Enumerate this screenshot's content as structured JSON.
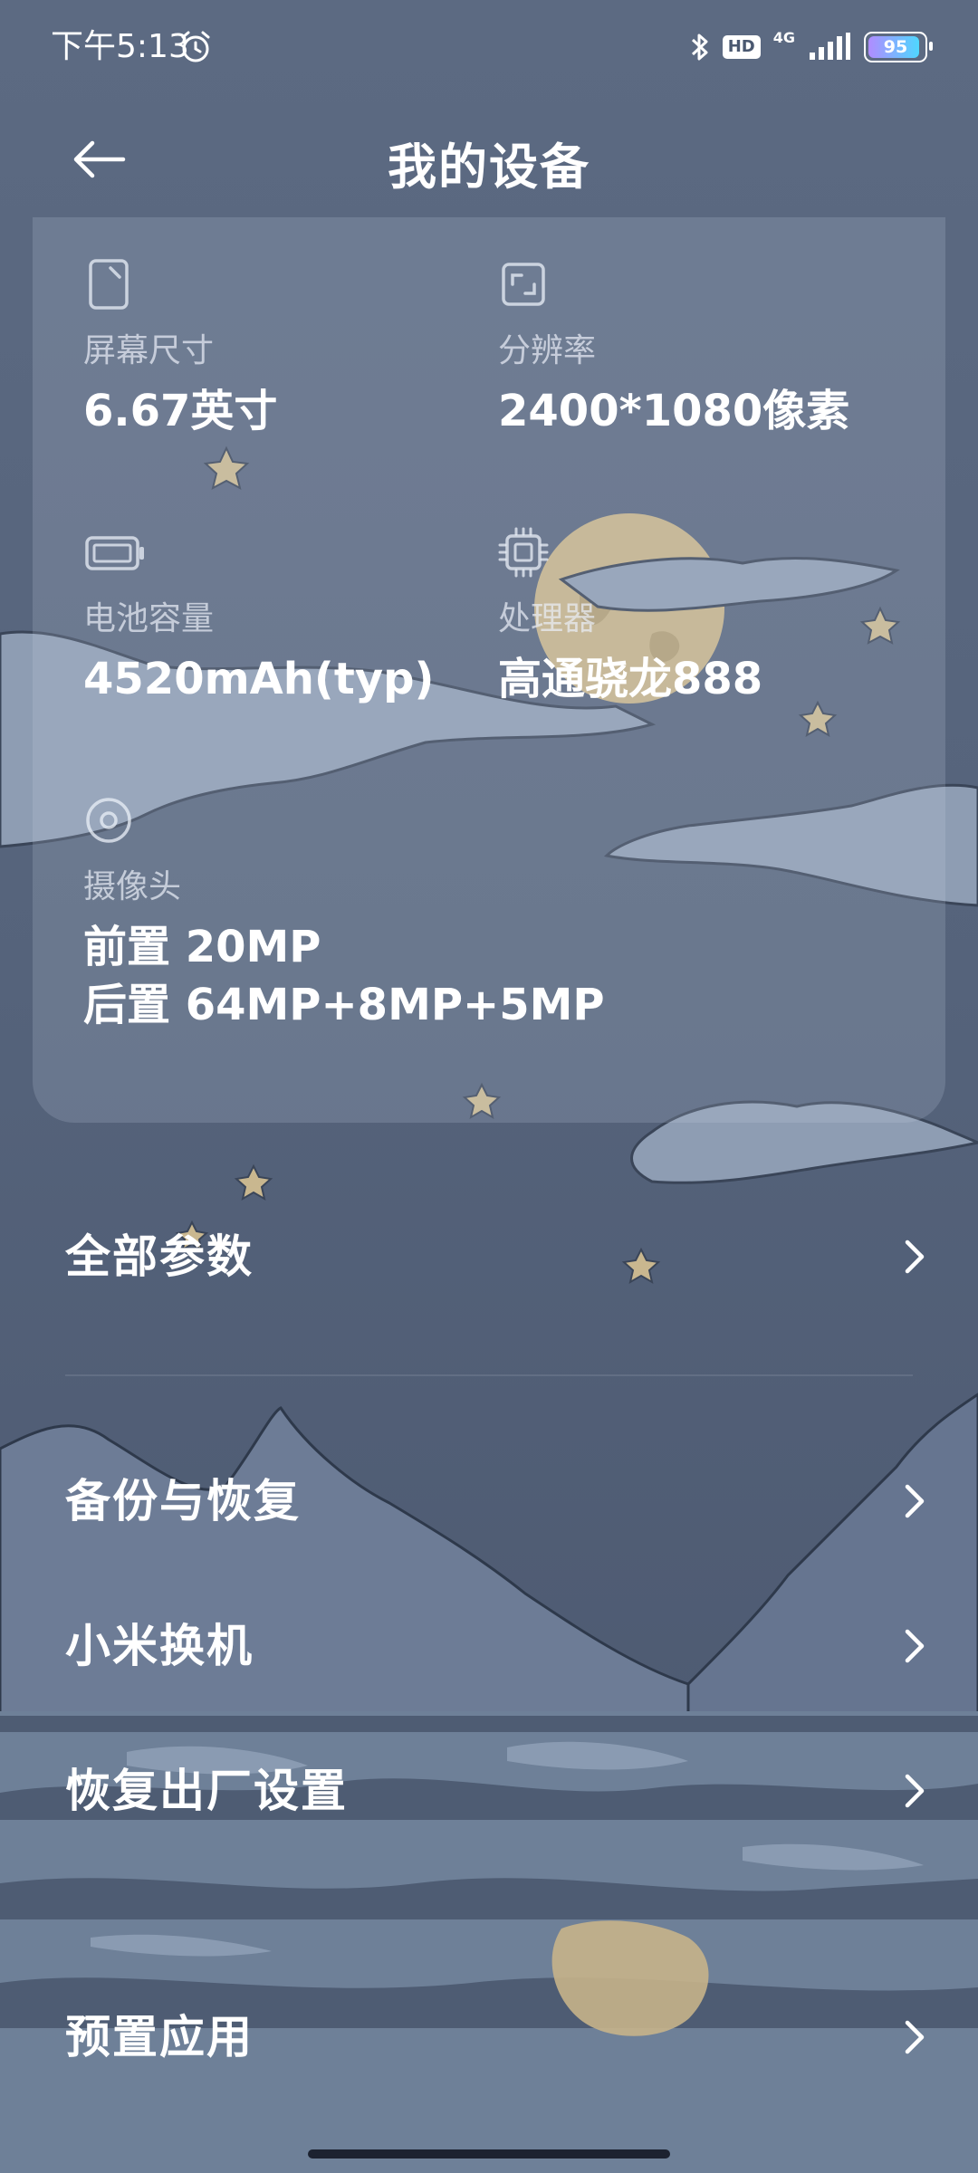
{
  "status_bar": {
    "time": "下午5:13",
    "hd_badge": "HD",
    "network": "4G",
    "battery": "95",
    "battery_level_percent": 95
  },
  "header": {
    "title": "我的设备",
    "back_icon": "arrow-left-icon"
  },
  "specs": {
    "screen": {
      "icon": "phone-screen-icon",
      "label": "屏幕尺寸",
      "value": "6.67英寸"
    },
    "resolution": {
      "icon": "resolution-icon",
      "label": "分辨率",
      "value": "2400*1080像素"
    },
    "battery": {
      "icon": "battery-icon",
      "label": "电池容量",
      "value": "4520mAh(typ)"
    },
    "processor": {
      "icon": "cpu-icon",
      "label": "处理器",
      "value": "高通骁龙888"
    },
    "camera": {
      "icon": "camera-icon",
      "label": "摄像头",
      "value_front": "前置 20MP",
      "value_rear": "后置 64MP+8MP+5MP"
    }
  },
  "menu": {
    "all_params": "全部参数",
    "backup": "备份与恢复",
    "mi_mover": "小米换机",
    "factory_reset": "恢复出厂设置",
    "preinstalled_apps": "预置应用"
  },
  "colors": {
    "sky": "#5d6b82",
    "cloud": "#9aa8bb",
    "moon": "#c8b48a",
    "star": "#c9b78f",
    "mountain": "#6f7f98"
  }
}
